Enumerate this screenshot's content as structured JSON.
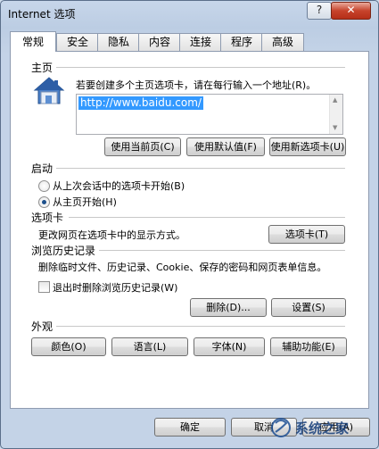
{
  "window": {
    "title": "Internet 选项",
    "help_label": "?",
    "close_label": "✕"
  },
  "tabs": [
    {
      "label": "常规",
      "active": true
    },
    {
      "label": "安全"
    },
    {
      "label": "隐私"
    },
    {
      "label": "内容"
    },
    {
      "label": "连接"
    },
    {
      "label": "程序"
    },
    {
      "label": "高级"
    }
  ],
  "homepage": {
    "heading": "主页",
    "description": "若要创建多个主页选项卡，请在每行输入一个地址(R)。",
    "url": "http://www.baidu.com/",
    "btn_current": "使用当前页(C)",
    "btn_default": "使用默认值(F)",
    "btn_newtab": "使用新选项卡(U)"
  },
  "startup": {
    "heading": "启动",
    "opt_last_session": "从上次会话中的选项卡开始(B)",
    "opt_homepage": "从主页开始(H)",
    "selected": "opt_homepage"
  },
  "tabsection": {
    "heading": "选项卡",
    "description": "更改网页在选项卡中的显示方式。",
    "button": "选项卡(T)"
  },
  "history": {
    "heading": "浏览历史记录",
    "description": "删除临时文件、历史记录、Cookie、保存的密码和网页表单信息。",
    "checkbox_label": "退出时删除浏览历史记录(W)",
    "checked": false,
    "btn_delete": "删除(D)...",
    "btn_settings": "设置(S)"
  },
  "appearance": {
    "heading": "外观",
    "btn_colors": "颜色(O)",
    "btn_languages": "语言(L)",
    "btn_fonts": "字体(N)",
    "btn_accessibility": "辅助功能(E)"
  },
  "footer": {
    "ok": "确定",
    "cancel": "取消",
    "apply": "应用(A)"
  },
  "watermark": {
    "text": "系统之家"
  }
}
